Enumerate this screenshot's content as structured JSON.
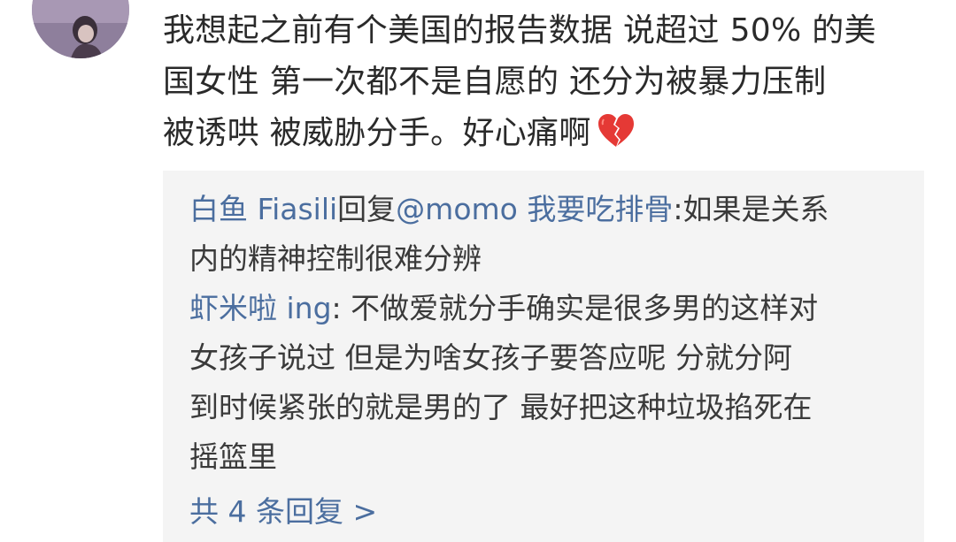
{
  "comment": {
    "lines": [
      "我想起之前有个美国的报告数据 说超过 50% 的美",
      "国女性 第一次都不是自愿的 还分为被暴力压制",
      "被诱哄 被威胁分手。好心痛啊"
    ],
    "emoji": "broken-heart-icon"
  },
  "replies": [
    {
      "user": "白鱼 Fiasili",
      "reply_word": "回复",
      "target": "@momo 我要吃排骨",
      "first_text": ":如果是关系",
      "more_lines": [
        "内的精神控制很难分辨"
      ]
    },
    {
      "user": "虾米啦 ing",
      "first_text": ": 不做爱就分手确实是很多男的这样对",
      "more_lines": [
        "女孩子说过 但是为啥女孩子要答应呢 分就分阿",
        "到时候紧张的就是男的了 最好把这种垃圾掐死在",
        "摇篮里"
      ]
    }
  ],
  "more_replies_label": "共 4 条回复 >",
  "colors": {
    "link": "#4b6e9f",
    "reply_bg": "#f4f4f4",
    "heart": "#e53935"
  }
}
